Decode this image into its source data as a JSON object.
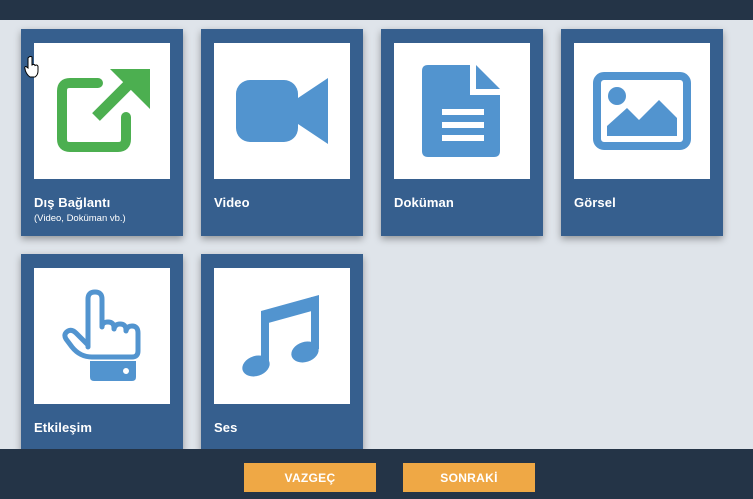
{
  "cards": [
    {
      "id": "external-link",
      "label": "Dış Bağlantı",
      "sub": "(Video, Doküman vb.)",
      "icon": "external-link-icon",
      "icon_color": "#4caf50"
    },
    {
      "id": "video",
      "label": "Video",
      "icon": "video-camera-icon",
      "icon_color": "#5294cf"
    },
    {
      "id": "document",
      "label": "Doküman",
      "icon": "document-icon",
      "icon_color": "#5294cf"
    },
    {
      "id": "image",
      "label": "Görsel",
      "icon": "image-icon",
      "icon_color": "#5294cf"
    },
    {
      "id": "interaction",
      "label": "Etkileşim",
      "icon": "touch-hand-icon",
      "icon_color": "#5294cf"
    },
    {
      "id": "audio",
      "label": "Ses",
      "icon": "music-note-icon",
      "icon_color": "#5294cf"
    }
  ],
  "footer": {
    "cancel_label": "VAZGEÇ",
    "next_label": "SONRAKİ"
  },
  "colors": {
    "card_bg": "#365f8e",
    "bar_bg": "#243447",
    "page_bg": "#dfe4ea",
    "button_bg": "#efa845"
  }
}
